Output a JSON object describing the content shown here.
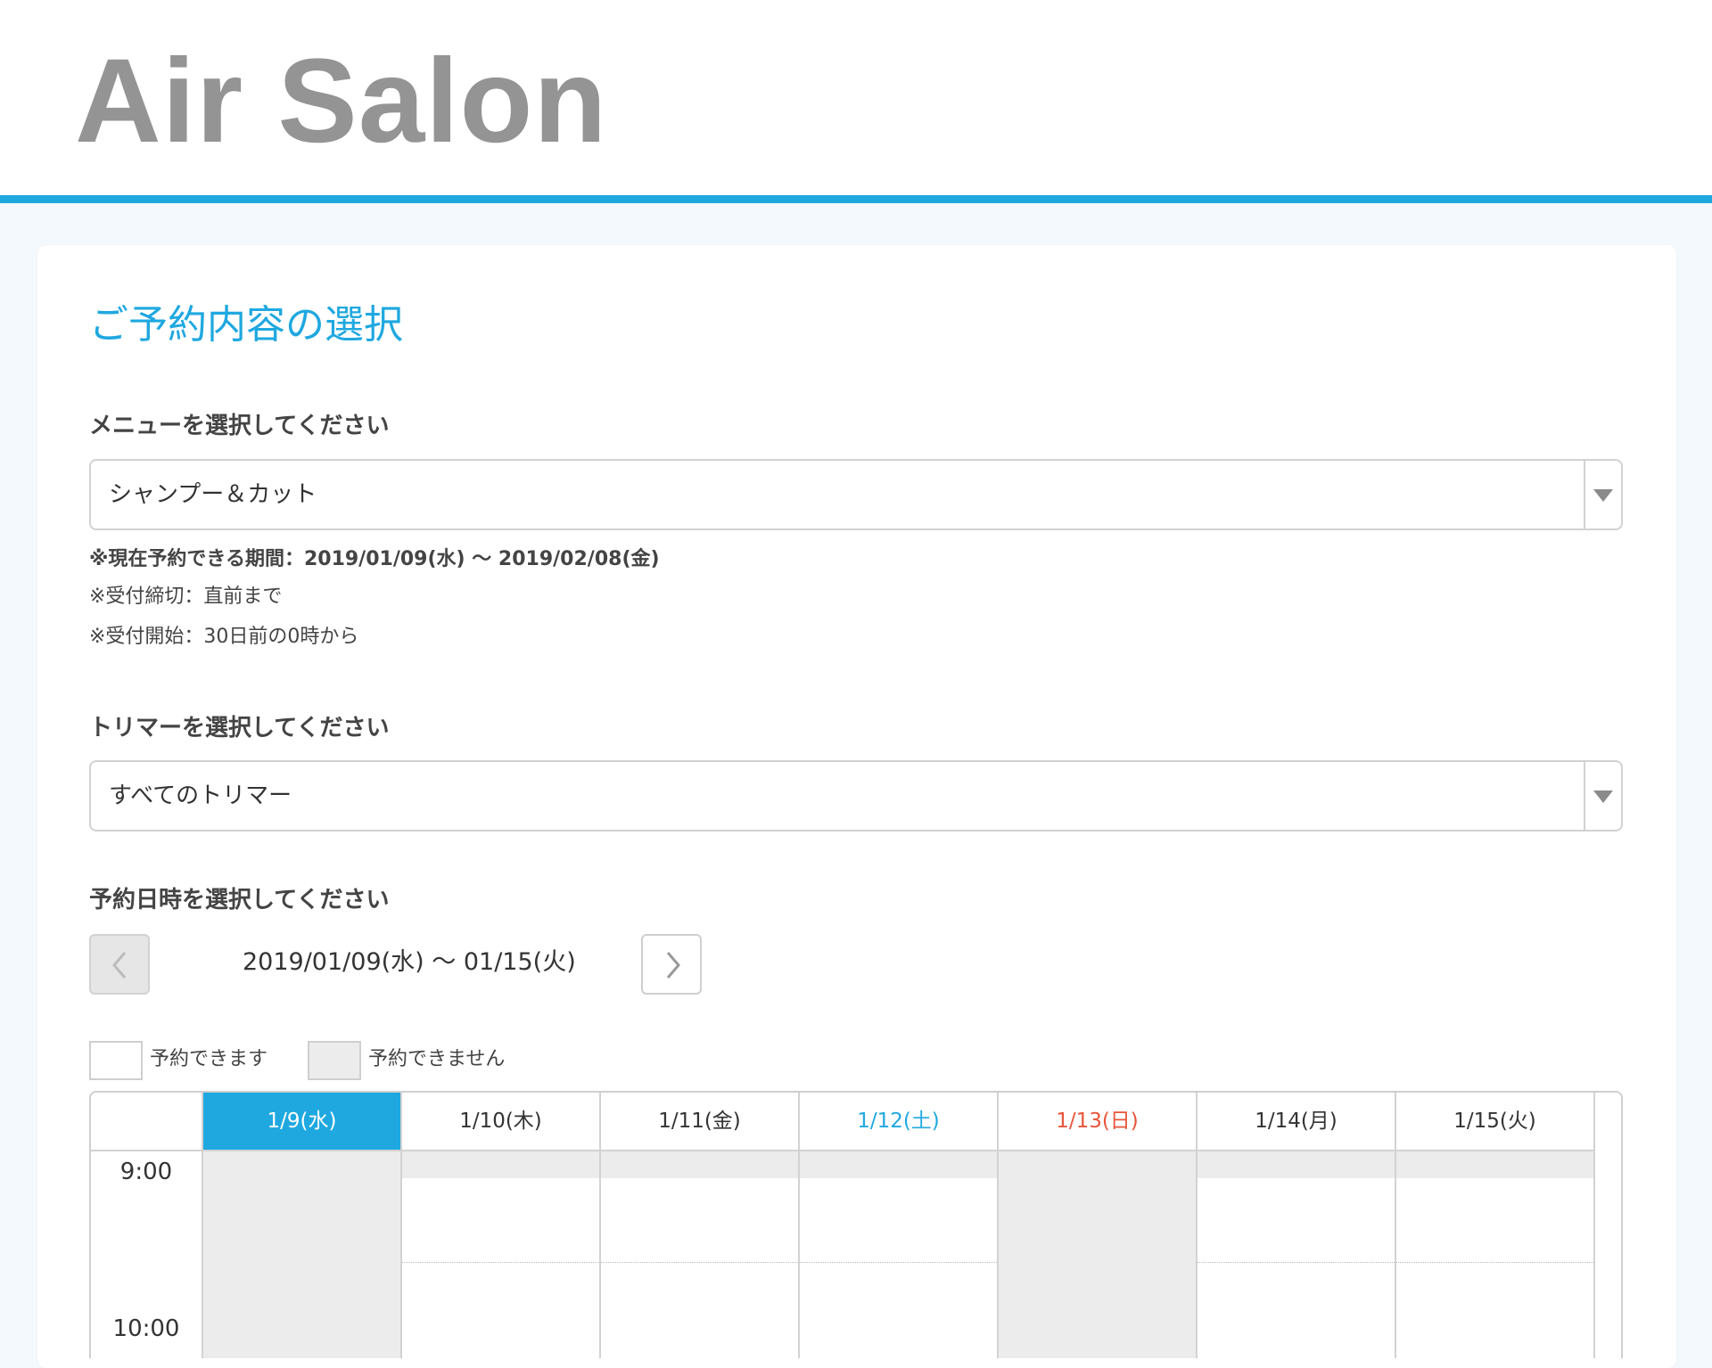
{
  "header": {
    "logo": "Air Salon"
  },
  "page_title": "ご予約内容の選択",
  "menu": {
    "label": "メニューを選択してください",
    "selected": "シャンプー＆カット"
  },
  "notes": {
    "period": "※現在予約できる期間：2019/01/09(水) 〜 2019/02/08(金)",
    "deadline": "※受付締切：直前まで",
    "start": "※受付開始：30日前の0時から"
  },
  "trimmer": {
    "label": "トリマーを選択してください",
    "selected": "すべてのトリマー"
  },
  "datetime": {
    "label": "予約日時を選択してください",
    "range": "2019/01/09(水) 〜 01/15(火)"
  },
  "legend": {
    "available": "予約できます",
    "unavailable": "予約できません"
  },
  "calendar": {
    "days": [
      {
        "label": "1/9(水)",
        "kind": "today",
        "closed": true
      },
      {
        "label": "1/10(木)",
        "kind": "weekday",
        "closed": false
      },
      {
        "label": "1/11(金)",
        "kind": "weekday",
        "closed": false
      },
      {
        "label": "1/12(土)",
        "kind": "sat",
        "closed": false
      },
      {
        "label": "1/13(日)",
        "kind": "sun",
        "closed": true
      },
      {
        "label": "1/14(月)",
        "kind": "weekday",
        "closed": false
      },
      {
        "label": "1/15(火)",
        "kind": "weekday",
        "closed": false
      }
    ],
    "times": [
      "9:00",
      "10:00"
    ]
  },
  "colors": {
    "accent": "#1fa8e0",
    "sunday": "#e8543a",
    "unavailable": "#ececec"
  }
}
